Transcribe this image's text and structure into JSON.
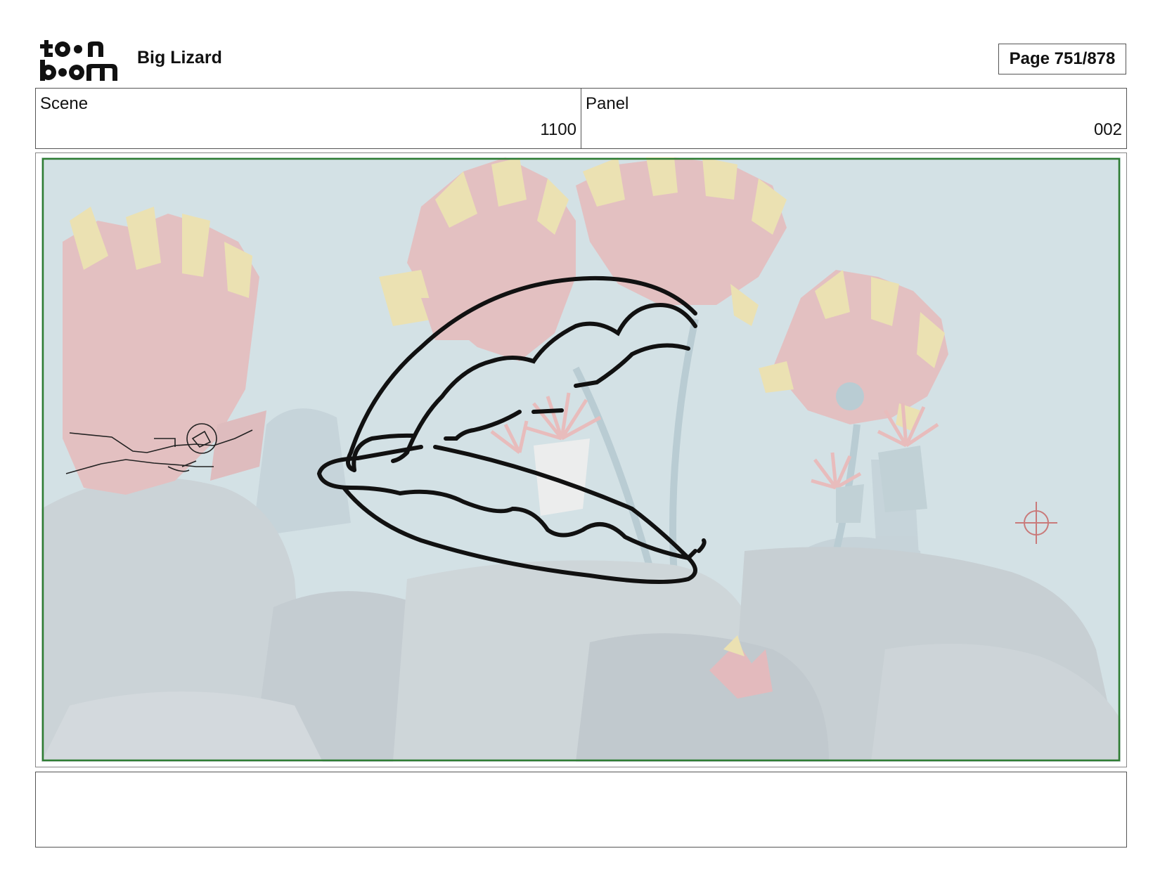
{
  "header": {
    "logo_text": "toon boom",
    "project_title": "Big Lizard",
    "page_label": "Page 751/878"
  },
  "info": {
    "scene_label": "Scene",
    "scene_value": "1100",
    "panel_label": "Panel",
    "panel_value": "002"
  },
  "panel": {
    "frame_color": "#2e7d32",
    "water_color": "#c3d6dc"
  },
  "notes": {
    "text": ""
  }
}
